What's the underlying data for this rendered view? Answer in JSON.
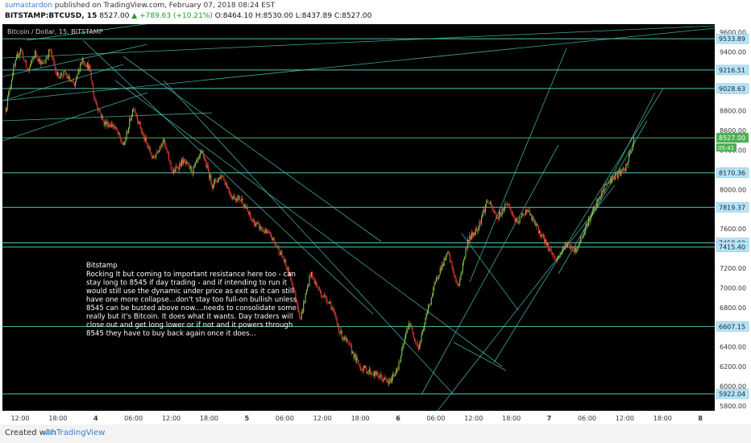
{
  "header": {
    "author": "sumastardon",
    "published_text": "published on TradingView.com, February 07, 2018 08:24 EST",
    "symbol": "BITSTAMP:BTCUSD, 15",
    "last": "8527.00",
    "change": "▲ +789.63 (+10.21%)",
    "open": "O:8464.10",
    "high": "H:8530.00",
    "low": "L:8437.89",
    "close": "C:8527.00"
  },
  "footer": {
    "created_with": "Created with",
    "brand": "TradingView"
  },
  "chart_data": {
    "type": "candlestick",
    "title": "Bitcoin / Dollar, 15, BITSTAMP",
    "ylim": [
      5750,
      9650
    ],
    "y_ticks": [
      5800,
      6000,
      6200,
      6400,
      6600,
      6800,
      7000,
      7200,
      7400,
      7600,
      7800,
      8000,
      8200,
      8400,
      8600,
      8800,
      9000,
      9200,
      9400,
      9600
    ],
    "x_ticks": [
      "12:00",
      "18:00",
      "4",
      "06:00",
      "12:00",
      "18:00",
      "5",
      "06:00",
      "12:00",
      "18:00",
      "6",
      "06:00",
      "12:00",
      "18:00",
      "7",
      "06:00",
      "12:00",
      "18:00",
      "8"
    ],
    "x_bold": [
      "4",
      "5",
      "6",
      "7",
      "8"
    ],
    "price_path": [
      [
        0,
        8820
      ],
      [
        1.5,
        9210
      ],
      [
        3,
        9440
      ],
      [
        4.5,
        9200
      ],
      [
        6,
        9390
      ],
      [
        7.5,
        9260
      ],
      [
        9,
        9420
      ],
      [
        10.5,
        9160
      ],
      [
        12,
        9180
      ],
      [
        14,
        9050
      ],
      [
        15.5,
        9330
      ],
      [
        17,
        9240
      ],
      [
        18,
        8930
      ],
      [
        20,
        8680
      ],
      [
        22,
        8650
      ],
      [
        24,
        8440
      ],
      [
        26,
        8850
      ],
      [
        28,
        8540
      ],
      [
        30,
        8310
      ],
      [
        32,
        8510
      ],
      [
        34,
        8170
      ],
      [
        36,
        8290
      ],
      [
        38,
        8190
      ],
      [
        40,
        8380
      ],
      [
        42,
        8050
      ],
      [
        44,
        8150
      ],
      [
        46,
        7930
      ],
      [
        48,
        7900
      ],
      [
        50,
        7690
      ],
      [
        52,
        7600
      ],
      [
        54,
        7520
      ],
      [
        56,
        7350
      ],
      [
        58,
        7100
      ],
      [
        60,
        6690
      ],
      [
        62,
        7150
      ],
      [
        64,
        6950
      ],
      [
        66,
        6850
      ],
      [
        68,
        6550
      ],
      [
        70,
        6400
      ],
      [
        72,
        6200
      ],
      [
        74,
        6150
      ],
      [
        76,
        6100
      ],
      [
        78,
        6030
      ],
      [
        80,
        6220
      ],
      [
        82,
        6650
      ],
      [
        84,
        6390
      ],
      [
        86,
        6800
      ],
      [
        88,
        7150
      ],
      [
        90,
        7350
      ],
      [
        92,
        7000
      ],
      [
        94,
        7480
      ],
      [
        96,
        7610
      ],
      [
        98,
        7890
      ],
      [
        100,
        7710
      ],
      [
        102,
        7870
      ],
      [
        104,
        7650
      ],
      [
        106,
        7800
      ],
      [
        108,
        7620
      ],
      [
        110,
        7450
      ],
      [
        112,
        7280
      ],
      [
        114,
        7450
      ],
      [
        116,
        7380
      ],
      [
        118,
        7620
      ],
      [
        120,
        7830
      ],
      [
        122,
        8050
      ],
      [
        124,
        8140
      ],
      [
        126,
        8200
      ],
      [
        128,
        8527
      ]
    ],
    "horizontal_levels": [
      {
        "value": 9533.89,
        "label": "9533.89"
      },
      {
        "value": 9216.51,
        "label": "9216.51"
      },
      {
        "value": 9028.63,
        "label": "9028.63"
      },
      {
        "value": 8170.36,
        "label": "8170.36"
      },
      {
        "value": 7819.37,
        "label": "7819.37"
      },
      {
        "value": 7458.02,
        "label": "7458.02"
      },
      {
        "value": 7415.4,
        "label": "7415.40"
      },
      {
        "value": 6607.15,
        "label": "6607.15"
      },
      {
        "value": 5922.04,
        "label": "5922.04"
      }
    ],
    "current_price": {
      "value": 8527.0,
      "label": "8527.00",
      "sub": "05:41"
    },
    "annotation": {
      "title": "Bitstamp",
      "lines": [
        "Rocking It but coming to important resistance here too - can",
        "stay long to 8545 if day trading - and if intending to run it",
        "would still use the dynamic under price as exit as it can still",
        "have one more collapse...don't stay too full-on bullish unless",
        "8545 can be busted above now....needs to consolidate some",
        "really but it's Bitcoin. It does what it wants. Day traders will",
        "close out and get long lower or if not and it powers through",
        "8545 they have to buy back again once it does..."
      ]
    },
    "colors": {
      "background": "#000000",
      "up": "#8bc34a",
      "down": "#e53935",
      "line": "#4fc3b4",
      "current": "#4caf50",
      "label_bg": "#b3e5fc"
    }
  }
}
